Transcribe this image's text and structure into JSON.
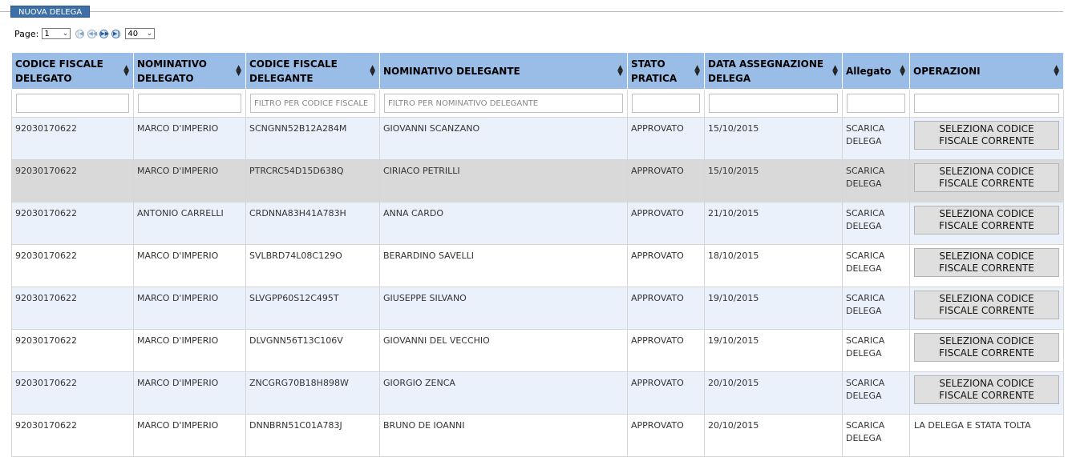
{
  "toolbar": {
    "new_label": "NUOVA DELEGA"
  },
  "pager": {
    "page_label": "Page:",
    "page_value": "1",
    "page_size": "40"
  },
  "columns": [
    {
      "line1": "CODICE FISCALE",
      "line2": "DELEGATO"
    },
    {
      "line1": "NOMINATIVO",
      "line2": "DELEGATO"
    },
    {
      "line1": "CODICE FISCALE",
      "line2": "DELEGANTE"
    },
    {
      "line1": "NOMINATIVO DELEGANTE",
      "line2": ""
    },
    {
      "line1": "STATO",
      "line2": "PRATICA"
    },
    {
      "line1": "DATA ASSEGNAZIONE",
      "line2": "DELEGA"
    },
    {
      "line1": "Allegato",
      "line2": ""
    },
    {
      "line1": "OPERAZIONI",
      "line2": ""
    }
  ],
  "filters": {
    "cf_delegante": "FILTRO PER CODICE FISCALE",
    "nom_delegante": "FILTRO PER NOMINATIVO DELEGANTE"
  },
  "rows": [
    {
      "cf_delegato": "92030170622",
      "nom_delegato": "MARCO D'IMPERIO",
      "cf_delegante": "SCNGNN52B12A284M",
      "nom_delegante": "GIOVANNI SCANZANO",
      "stato": "APPROVATO",
      "data": "15/10/2015",
      "allegato_1": "SCARICA",
      "allegato_2": "DELEGA",
      "op_1": "SELEZIONA CODICE",
      "op_2": "FISCALE CORRENTE"
    },
    {
      "cf_delegato": "92030170622",
      "nom_delegato": "MARCO D'IMPERIO",
      "cf_delegante": "PTRCRC54D15D638Q",
      "nom_delegante": "CIRIACO PETRILLI",
      "stato": "APPROVATO",
      "data": "15/10/2015",
      "allegato_1": "SCARICA",
      "allegato_2": "DELEGA",
      "op_1": "SELEZIONA CODICE",
      "op_2": "FISCALE CORRENTE"
    },
    {
      "cf_delegato": "92030170622",
      "nom_delegato": "ANTONIO CARRELLI",
      "cf_delegante": "CRDNNA83H41A783H",
      "nom_delegante": "ANNA CARDO",
      "stato": "APPROVATO",
      "data": "21/10/2015",
      "allegato_1": "SCARICA",
      "allegato_2": "DELEGA",
      "op_1": "SELEZIONA CODICE",
      "op_2": "FISCALE CORRENTE"
    },
    {
      "cf_delegato": "92030170622",
      "nom_delegato": "MARCO D'IMPERIO",
      "cf_delegante": "SVLBRD74L08C129O",
      "nom_delegante": "BERARDINO SAVELLI",
      "stato": "APPROVATO",
      "data": "18/10/2015",
      "allegato_1": "SCARICA",
      "allegato_2": "DELEGA",
      "op_1": "SELEZIONA CODICE",
      "op_2": "FISCALE CORRENTE"
    },
    {
      "cf_delegato": "92030170622",
      "nom_delegato": "MARCO D'IMPERIO",
      "cf_delegante": "SLVGPP60S12C495T",
      "nom_delegante": "GIUSEPPE SILVANO",
      "stato": "APPROVATO",
      "data": "19/10/2015",
      "allegato_1": "SCARICA",
      "allegato_2": "DELEGA",
      "op_1": "SELEZIONA CODICE",
      "op_2": "FISCALE CORRENTE"
    },
    {
      "cf_delegato": "92030170622",
      "nom_delegato": "MARCO D'IMPERIO",
      "cf_delegante": "DLVGNN56T13C106V",
      "nom_delegante": "GIOVANNI DEL VECCHIO",
      "stato": "APPROVATO",
      "data": "19/10/2015",
      "allegato_1": "SCARICA",
      "allegato_2": "DELEGA",
      "op_1": "SELEZIONA CODICE",
      "op_2": "FISCALE CORRENTE"
    },
    {
      "cf_delegato": "92030170622",
      "nom_delegato": "MARCO D'IMPERIO",
      "cf_delegante": "ZNCGRG70B18H898W",
      "nom_delegante": "GIORGIO ZENCA",
      "stato": "APPROVATO",
      "data": "20/10/2015",
      "allegato_1": "SCARICA",
      "allegato_2": "DELEGA",
      "op_1": "SELEZIONA CODICE",
      "op_2": "FISCALE CORRENTE"
    },
    {
      "cf_delegato": "92030170622",
      "nom_delegato": "MARCO D'IMPERIO",
      "cf_delegante": "DNNBRN51C01A783J",
      "nom_delegante": "BRUNO DE IOANNI",
      "stato": "APPROVATO",
      "data": "20/10/2015",
      "allegato_1": "SCARICA",
      "allegato_2": "DELEGA",
      "op_text": "LA DELEGA E STATA TOLTA"
    }
  ]
}
